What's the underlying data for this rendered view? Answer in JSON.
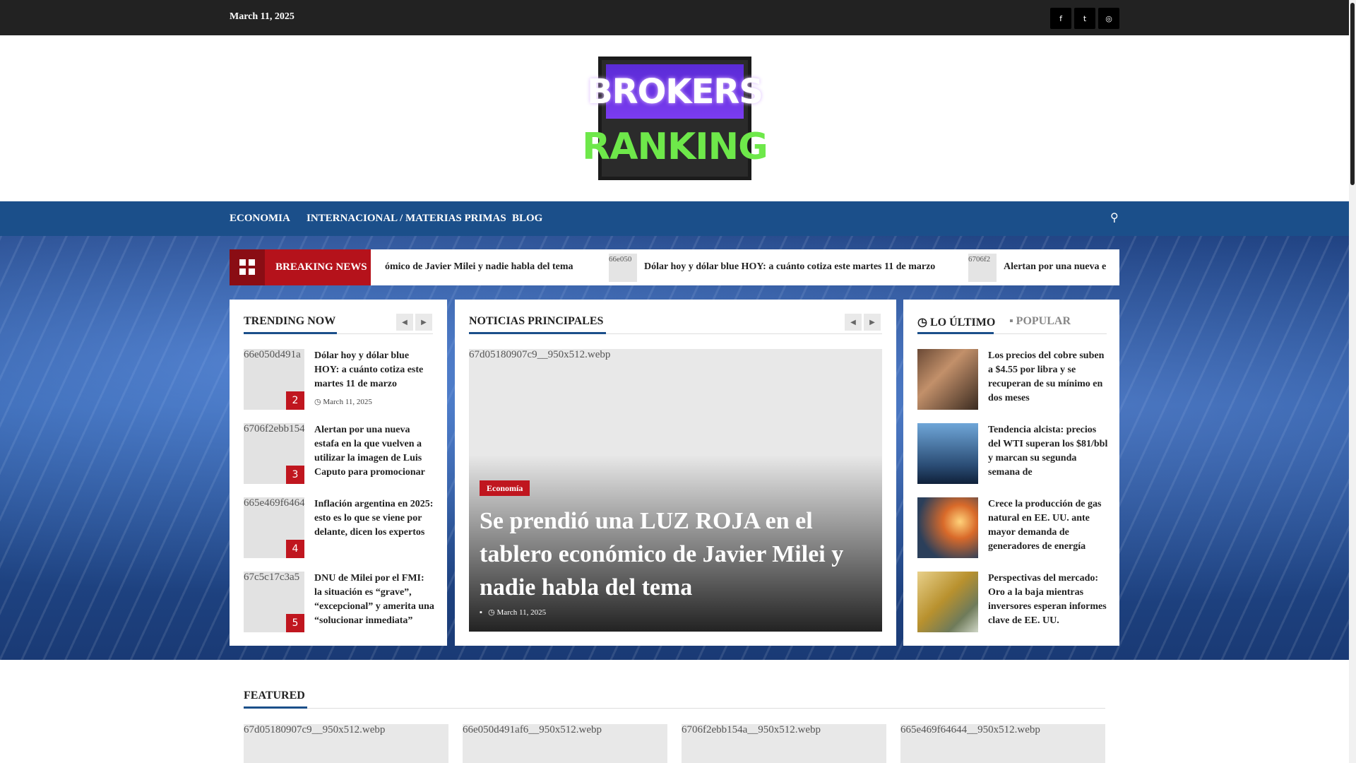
{
  "topbar": {
    "date": "March 11, 2025",
    "social_icons": [
      "facebook-icon",
      "twitter-icon",
      "instagram-icon"
    ]
  },
  "logo": {
    "line1": "BROKERS",
    "line2": "RANKING"
  },
  "nav": {
    "items": [
      "ECONOMIA",
      "INTERNACIONAL / MATERIAS PRIMAS",
      "BLOG"
    ],
    "search_icon": "search-icon"
  },
  "breaking": {
    "label": "BREAKING NEWS",
    "items": [
      {
        "thumb": "",
        "text": "ómico de Javier Milei y nadie habla del tema"
      },
      {
        "thumb": "66e050",
        "text": "Dólar hoy y dólar blue HOY: a cuánto cotiza este martes 11 de marzo"
      },
      {
        "thumb": "6706f2",
        "text": "Alertan por una nueva e"
      }
    ]
  },
  "trending": {
    "title": "TRENDING NOW",
    "items": [
      {
        "img_alt": "66e050d491a",
        "num": "2",
        "title": "Dólar hoy y dólar blue HOY: a cuánto cotiza este martes 11 de marzo",
        "date": "March 11, 2025"
      },
      {
        "img_alt": "6706f2ebb154",
        "num": "3",
        "title": "Alertan por una nueva estafa en la que vuelven a utilizar la imagen de Luis Caputo para promocionar",
        "date": ""
      },
      {
        "img_alt": "665e469f6464",
        "num": "4",
        "title": "Inflación argentina en 2025: esto es lo que se viene por delante, dicen los expertos",
        "date": ""
      },
      {
        "img_alt": "67c5c17c3a5",
        "num": "5",
        "title": "DNU de Milei por el FMI: la situación es “grave”, “excepcional” y amerita una “solucionar inmediata”",
        "date": ""
      }
    ]
  },
  "main": {
    "title": "NOTICIAS PRINCIPALES",
    "img_alt": "67d05180907c9__950x512.webp",
    "category": "Economía",
    "headline": "Se prendió una LUZ ROJA en el tablero económico de Javier Milei y nadie habla del tema",
    "date": "March 11, 2025"
  },
  "side": {
    "tabs": [
      "LO ÚLTIMO",
      "POPULAR"
    ],
    "items": [
      {
        "title": "Los precios del cobre suben a $4.55 por libra y se recuperan de su mínimo en dos meses"
      },
      {
        "title": "Tendencia alcista: precios del WTI superan los $81/bbl y marcan su segunda semana de"
      },
      {
        "title": "Crece la producción de gas natural en EE. UU. ante mayor demanda de generadores de energía"
      },
      {
        "title": "Perspectivas del mercado: Oro a la baja mientras inversores esperan informes clave de EE. UU."
      }
    ]
  },
  "featured": {
    "title": "FEATURED",
    "items": [
      "67d05180907c9__950x512.webp",
      "66e050d491af6__950x512.webp",
      "6706f2ebb154a__950x512.webp",
      "665e469f64644__950x512.webp"
    ]
  }
}
